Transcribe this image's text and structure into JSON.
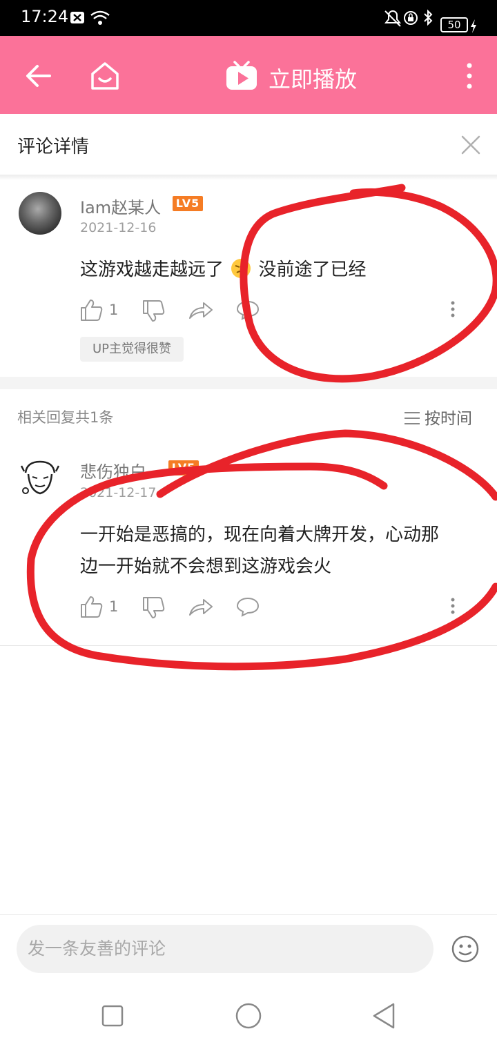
{
  "status_bar": {
    "time": "17:24",
    "battery": "50"
  },
  "app_bar": {
    "title": "立即播放"
  },
  "subheader": {
    "title": "评论详情"
  },
  "main_comment": {
    "username": "Iam赵某人",
    "level": "LV5",
    "date": "2021-12-16",
    "content_part1": "这游戏越走越远了",
    "content_part2": "没前途了已经",
    "likes": "1",
    "badge": "UP主觉得很赞"
  },
  "replies_header": {
    "label": "相关回复共1条",
    "sort_label": "按时间"
  },
  "reply": {
    "username": "悲伤独白",
    "level": "LV5",
    "date": "2021-12-17",
    "content_line1": "一开始是恶搞的，现在向着大牌开发，心动那",
    "content_line2": "边一开始就不会想到这游戏会火",
    "likes": "1"
  },
  "composer": {
    "placeholder": "发一条友善的评论"
  },
  "colors": {
    "brand_pink": "#fb7299",
    "level_orange": "#f57c24",
    "annotation_red": "#e8232a"
  }
}
